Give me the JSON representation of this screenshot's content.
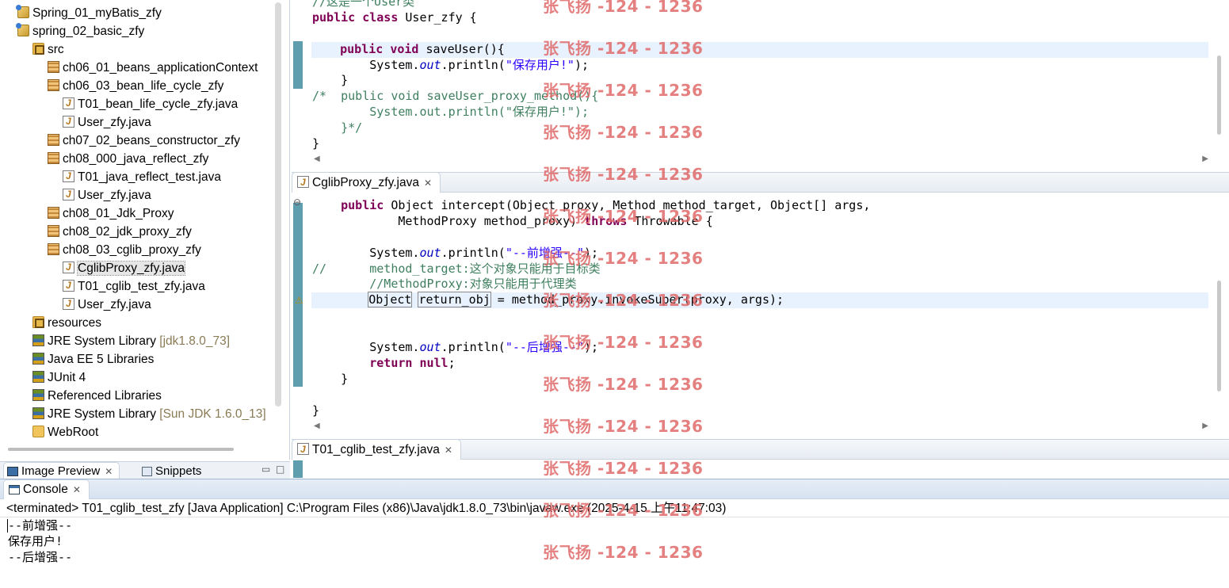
{
  "explorer": {
    "items": [
      {
        "label": "Spring_01_myBatis_zfy",
        "suffix": "",
        "icon": "project-icon"
      },
      {
        "label": "spring_02_basic_zfy",
        "suffix": "",
        "icon": "project-icon"
      },
      {
        "label": "src",
        "suffix": "",
        "icon": "source-folder-icon"
      },
      {
        "label": "ch06_01_beans_applicationContext",
        "suffix": "",
        "icon": "package-icon"
      },
      {
        "label": "ch06_03_bean_life_cycle_zfy",
        "suffix": "",
        "icon": "package-icon"
      },
      {
        "label": "T01_bean_life_cycle_zfy.java",
        "suffix": "",
        "icon": "java-file-icon"
      },
      {
        "label": "User_zfy.java",
        "suffix": "",
        "icon": "java-file-icon"
      },
      {
        "label": "ch07_02_beans_constructor_zfy",
        "suffix": "",
        "icon": "package-icon"
      },
      {
        "label": "ch08_000_java_reflect_zfy",
        "suffix": "",
        "icon": "package-icon"
      },
      {
        "label": "T01_java_reflect_test.java",
        "suffix": "",
        "icon": "java-file-icon"
      },
      {
        "label": "User_zfy.java",
        "suffix": "",
        "icon": "java-file-icon"
      },
      {
        "label": "ch08_01_Jdk_Proxy",
        "suffix": "",
        "icon": "package-icon"
      },
      {
        "label": "ch08_02_jdk_proxy_zfy",
        "suffix": "",
        "icon": "package-icon"
      },
      {
        "label": "ch08_03_cglib_proxy_zfy",
        "suffix": "",
        "icon": "package-icon"
      },
      {
        "label": "CglibProxy_zfy.java",
        "suffix": "",
        "icon": "java-file-icon",
        "selected": true
      },
      {
        "label": "T01_cglib_test_zfy.java",
        "suffix": "",
        "icon": "java-file-icon"
      },
      {
        "label": "User_zfy.java",
        "suffix": "",
        "icon": "java-file-icon"
      },
      {
        "label": "resources",
        "suffix": "",
        "icon": "source-folder-icon"
      },
      {
        "label": "JRE System Library",
        "suffix": "[jdk1.8.0_73]",
        "icon": "library-icon"
      },
      {
        "label": "Java EE 5 Libraries",
        "suffix": "",
        "icon": "library-icon"
      },
      {
        "label": "JUnit 4",
        "suffix": "",
        "icon": "library-icon"
      },
      {
        "label": "Referenced Libraries",
        "suffix": "",
        "icon": "library-icon"
      },
      {
        "label": "JRE System Library",
        "suffix": "[Sun JDK 1.6.0_13]",
        "icon": "library-icon"
      },
      {
        "label": "WebRoot",
        "suffix": "",
        "icon": "folder-icon"
      }
    ]
  },
  "editor1": {
    "lines": [
      [
        {
          "t": "//这是一个User类",
          "c": "cmt"
        }
      ],
      [
        {
          "t": "public",
          "c": "kw"
        },
        {
          "t": " "
        },
        {
          "t": "class",
          "c": "kw"
        },
        {
          "t": " User_zfy {"
        }
      ],
      [
        {
          "t": ""
        }
      ],
      [
        {
          "t": "    "
        },
        {
          "t": "public",
          "c": "kw"
        },
        {
          "t": " "
        },
        {
          "t": "void",
          "c": "kw"
        },
        {
          "t": " saveUser(){"
        }
      ],
      [
        {
          "t": "        System."
        },
        {
          "t": "out",
          "c": "fld"
        },
        {
          "t": ".println("
        },
        {
          "t": "\"保存用户!\"",
          "c": "str"
        },
        {
          "t": ");"
        }
      ],
      [
        {
          "t": "    }"
        }
      ],
      [
        {
          "t": "/*  public void saveUser_proxy_method(){",
          "c": "cmt"
        }
      ],
      [
        {
          "t": "        System.out.println(\"保存用户!\");",
          "c": "cmt"
        }
      ],
      [
        {
          "t": "    }*/",
          "c": "cmt"
        }
      ],
      [
        {
          "t": "}"
        }
      ]
    ]
  },
  "editor2": {
    "tab": "CglibProxy_zfy.java",
    "lines": [
      [
        {
          "t": "    "
        },
        {
          "t": "public",
          "c": "kw"
        },
        {
          "t": " Object intercept(Object proxy, Method method_target, Object[] args,"
        }
      ],
      [
        {
          "t": "            MethodProxy method_proxy) "
        },
        {
          "t": "throws",
          "c": "kw"
        },
        {
          "t": " Throwable {"
        }
      ],
      [
        {
          "t": ""
        }
      ],
      [
        {
          "t": "        System."
        },
        {
          "t": "out",
          "c": "fld"
        },
        {
          "t": ".println("
        },
        {
          "t": "\"--前增强--\"",
          "c": "str"
        },
        {
          "t": ");"
        }
      ],
      [
        {
          "t": "//      method_target:这个对象只能用于目标类",
          "c": "cmt"
        }
      ],
      [
        {
          "t": "        //MethodProxy:对象只能用于代理类",
          "c": "cmt"
        }
      ],
      [
        {
          "t": "        "
        },
        {
          "t": "Object",
          "c": "box"
        },
        {
          "t": " "
        },
        {
          "t": "return_obj",
          "c": "box"
        },
        {
          "t": " = method_proxy.invokeSuper(proxy, args);"
        }
      ],
      [
        {
          "t": ""
        }
      ],
      [
        {
          "t": ""
        }
      ],
      [
        {
          "t": "        System."
        },
        {
          "t": "out",
          "c": "fld"
        },
        {
          "t": ".println("
        },
        {
          "t": "\"--后增强--\"",
          "c": "str"
        },
        {
          "t": ");"
        }
      ],
      [
        {
          "t": "        "
        },
        {
          "t": "return",
          "c": "kw"
        },
        {
          "t": " "
        },
        {
          "t": "null",
          "c": "kw"
        },
        {
          "t": ";"
        }
      ],
      [
        {
          "t": "    }"
        }
      ],
      [
        {
          "t": ""
        }
      ],
      [
        {
          "t": "}"
        }
      ]
    ]
  },
  "editor3": {
    "tab": "T01_cglib_test_zfy.java"
  },
  "bottom_left_tabs": {
    "image_preview": "Image Preview",
    "snippets": "Snippets"
  },
  "console": {
    "tab": "Console",
    "status": "<terminated> T01_cglib_test_zfy [Java Application] C:\\Program Files (x86)\\Java\\jdk1.8.0_73\\bin\\javaw.exe (2025-4-15 上午11:47:03)",
    "output": [
      "--前增强--",
      "保存用户!",
      "--后增强--"
    ]
  },
  "watermark": "张飞扬 -124 - 1236",
  "colors": {
    "keyword": "#7f0055",
    "string": "#2a00ff",
    "comment": "#3f7f5f",
    "field": "#0000c0",
    "watermark": "#e06a6a",
    "line_highlight": "#e8f2fe"
  }
}
